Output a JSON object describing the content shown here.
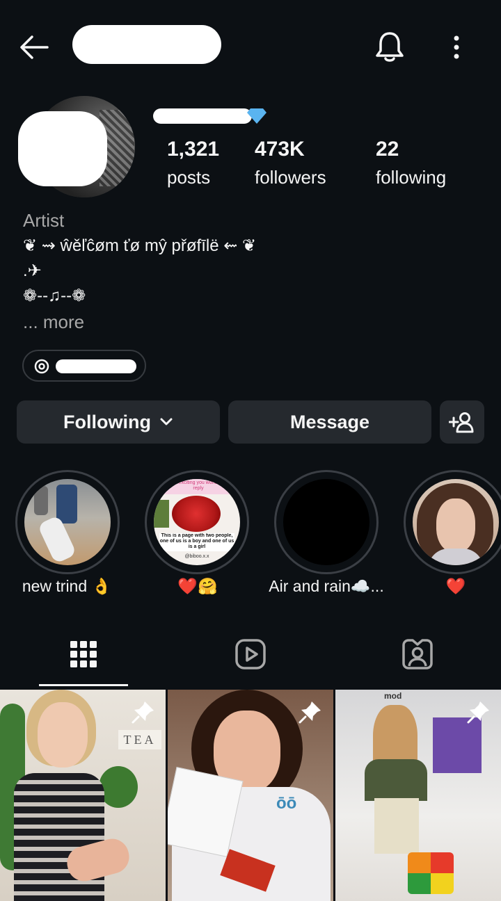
{
  "header": {
    "back_icon": "arrow-left-icon",
    "username": "",
    "bell_icon": "bell-icon",
    "more_icon": "more-vertical-icon"
  },
  "profile": {
    "display_name": "",
    "stats": [
      {
        "value": "1,321",
        "label": "posts"
      },
      {
        "value": "473K",
        "label": "followers"
      },
      {
        "value": "22",
        "label": "following"
      }
    ],
    "category": "Artist",
    "bio": [
      "❦ ⇝ ŵěľĉøm ťø mŷ přøfīlë ⇜ ❦",
      ".✈",
      "❁--♫--❁"
    ],
    "more": "... more",
    "threads_icon": "threads-icon"
  },
  "actions": {
    "following_label": "Following",
    "message_label": "Message",
    "add_person_icon": "add-person-icon"
  },
  "highlights": [
    {
      "label": "new trind 👌"
    },
    {
      "label": "❤️🤗",
      "text_top": "just exciting you wonderful reply",
      "text_box": "This is a page with two people, one of us is a boy and one of us is a girl",
      "handle": "@biboo.x.x"
    },
    {
      "label": "Air and rain☁️..."
    },
    {
      "label": "❤️"
    }
  ],
  "tabs": [
    {
      "icon": "grid-icon",
      "active": true
    },
    {
      "icon": "reels-icon",
      "active": false
    },
    {
      "icon": "tagged-icon",
      "active": false
    }
  ],
  "posts": [
    {
      "pinned": true,
      "sign_text": "TEA"
    },
    {
      "pinned": true,
      "sign_text": "ōō"
    },
    {
      "pinned": true,
      "sign_text": "mod"
    }
  ],
  "colors": {
    "background": "#0c1014",
    "button": "#25292e",
    "muted": "#a8a8a8"
  }
}
